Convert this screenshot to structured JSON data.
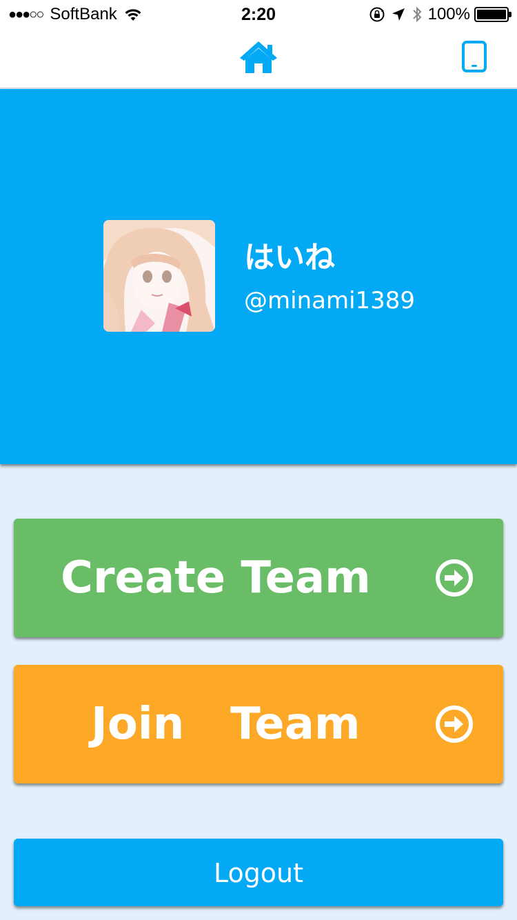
{
  "status_bar": {
    "signal_dots": "●●●○○",
    "carrier": "SoftBank",
    "time": "2:20",
    "battery_percent": "100%"
  },
  "nav": {
    "home_icon": "home-icon",
    "tablet_icon": "tablet-icon",
    "accent_color": "#03a9f4"
  },
  "profile": {
    "display_name": "はいね",
    "username": "@minami1389"
  },
  "actions": {
    "create_label": "Create Team",
    "join_label": "Join   Team",
    "logout_label": "Logout"
  },
  "colors": {
    "header": "#03a9f4",
    "create": "#69bd67",
    "join": "#fda826",
    "background": "#e3f0fb"
  }
}
